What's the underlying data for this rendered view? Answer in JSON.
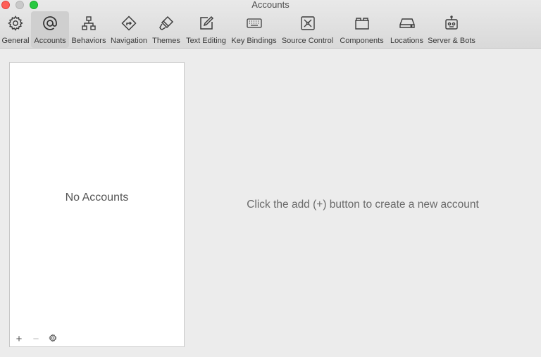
{
  "window": {
    "title": "Accounts"
  },
  "toolbar": {
    "items": [
      {
        "label": "General",
        "icon": "gear-icon"
      },
      {
        "label": "Accounts",
        "icon": "at-sign-icon",
        "active": true
      },
      {
        "label": "Behaviors",
        "icon": "hierarchy-icon"
      },
      {
        "label": "Navigation",
        "icon": "navigation-arrow-icon"
      },
      {
        "label": "Themes",
        "icon": "paintbrush-icon"
      },
      {
        "label": "Text Editing",
        "icon": "edit-pencil-icon"
      },
      {
        "label": "Key Bindings",
        "icon": "keyboard-icon"
      },
      {
        "label": "Source Control",
        "icon": "source-control-icon"
      },
      {
        "label": "Components",
        "icon": "folder-tabs-icon"
      },
      {
        "label": "Locations",
        "icon": "drive-icon"
      },
      {
        "label": "Server & Bots",
        "icon": "robot-icon"
      }
    ]
  },
  "accounts_list": {
    "empty_text": "No Accounts",
    "add_label": "+",
    "remove_label": "−"
  },
  "detail": {
    "hint": "Click the add (+) button to create a new account"
  },
  "colors": {
    "toolbar_active": "#cfcfcf",
    "close": "#fe5f57",
    "minimize": "#c9c9c9",
    "zoom": "#28c840"
  }
}
